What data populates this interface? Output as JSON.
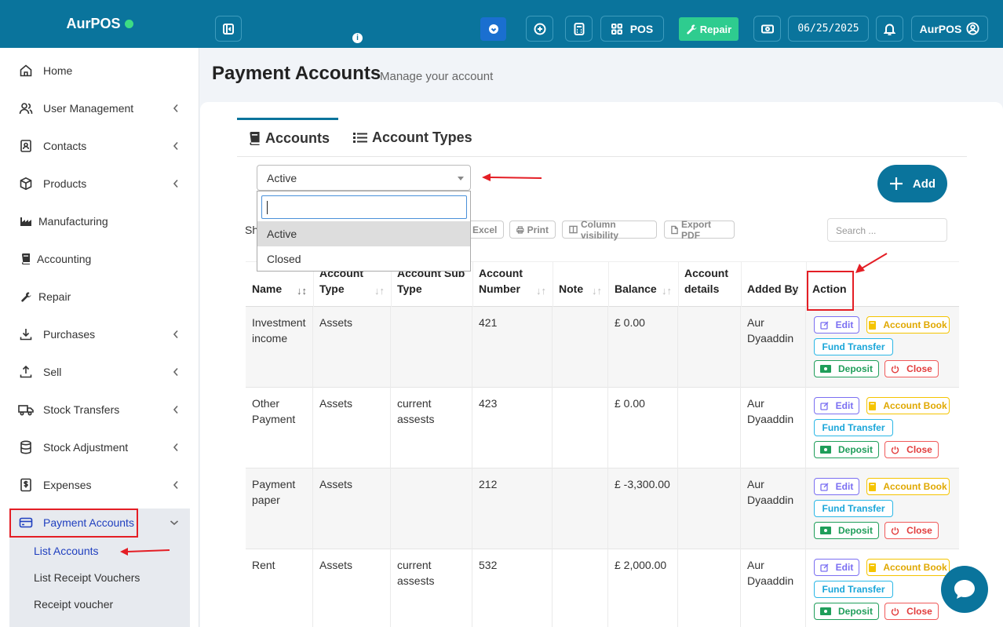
{
  "brand": "AurPOS",
  "topbar": {
    "pos_label": "POS",
    "repair_label": "Repair",
    "date": "06/25/2025",
    "user": "AurPOS"
  },
  "sidebar": {
    "items": [
      {
        "label": "Home",
        "icon": "home-icon"
      },
      {
        "label": "User Management",
        "icon": "users-icon"
      },
      {
        "label": "Contacts",
        "icon": "contacts-icon"
      },
      {
        "label": "Products",
        "icon": "box-icon"
      },
      {
        "label": "Manufacturing",
        "icon": "factory-icon"
      },
      {
        "label": "Accounting",
        "icon": "book-icon"
      },
      {
        "label": "Repair",
        "icon": "wrench-icon"
      },
      {
        "label": "Purchases",
        "icon": "download-icon"
      },
      {
        "label": "Sell",
        "icon": "upload-icon"
      },
      {
        "label": "Stock Transfers",
        "icon": "truck-icon"
      },
      {
        "label": "Stock Adjustment",
        "icon": "database-icon"
      },
      {
        "label": "Expenses",
        "icon": "dollar-receipt-icon"
      },
      {
        "label": "Payment Accounts",
        "icon": "card-icon"
      }
    ],
    "submenu": [
      "List Accounts",
      "List Receipt Vouchers",
      "Receipt voucher"
    ]
  },
  "page": {
    "title": "Payment Accounts",
    "subtitle": "Manage your account"
  },
  "tabs": [
    "Accounts",
    "Account Types"
  ],
  "filter": {
    "selected": "Active",
    "options": [
      "Active",
      "Closed"
    ]
  },
  "add_label": "Add",
  "show_label": "Sh",
  "export_buttons": [
    "Excel",
    "Print",
    "Column visibility",
    "Export PDF"
  ],
  "search_placeholder": "Search ...",
  "table": {
    "headers": [
      "Name",
      "Account Type",
      "Account Sub Type",
      "Account Number",
      "Note",
      "Balance",
      "Account details",
      "Added By",
      "Action"
    ],
    "rows": [
      {
        "name": "Investment income",
        "type": "Assets",
        "subtype": "",
        "number": "421",
        "note": "",
        "balance": "£ 0.00",
        "details": "",
        "added_by": "Aur Dyaaddin"
      },
      {
        "name": "Other Payment",
        "type": "Assets",
        "subtype": "current assests",
        "number": "423",
        "note": "",
        "balance": "£ 0.00",
        "details": "",
        "added_by": "Aur Dyaaddin"
      },
      {
        "name": "Payment paper",
        "type": "Assets",
        "subtype": "",
        "number": "212",
        "note": "",
        "balance": "£ -3,300.00",
        "details": "",
        "added_by": "Aur Dyaaddin"
      },
      {
        "name": "Rent",
        "type": "Assets",
        "subtype": "current assests",
        "number": "532",
        "note": "",
        "balance": "£ 2,000.00",
        "details": "",
        "added_by": "Aur Dyaaddin"
      }
    ],
    "actions": {
      "edit": "Edit",
      "account_book": "Account Book",
      "fund_transfer": "Fund Transfer",
      "deposit": "Deposit",
      "close": "Close"
    }
  },
  "colors": {
    "primary": "#0a749c",
    "repair": "#2ecc8f",
    "annotation": "#e41e25"
  }
}
